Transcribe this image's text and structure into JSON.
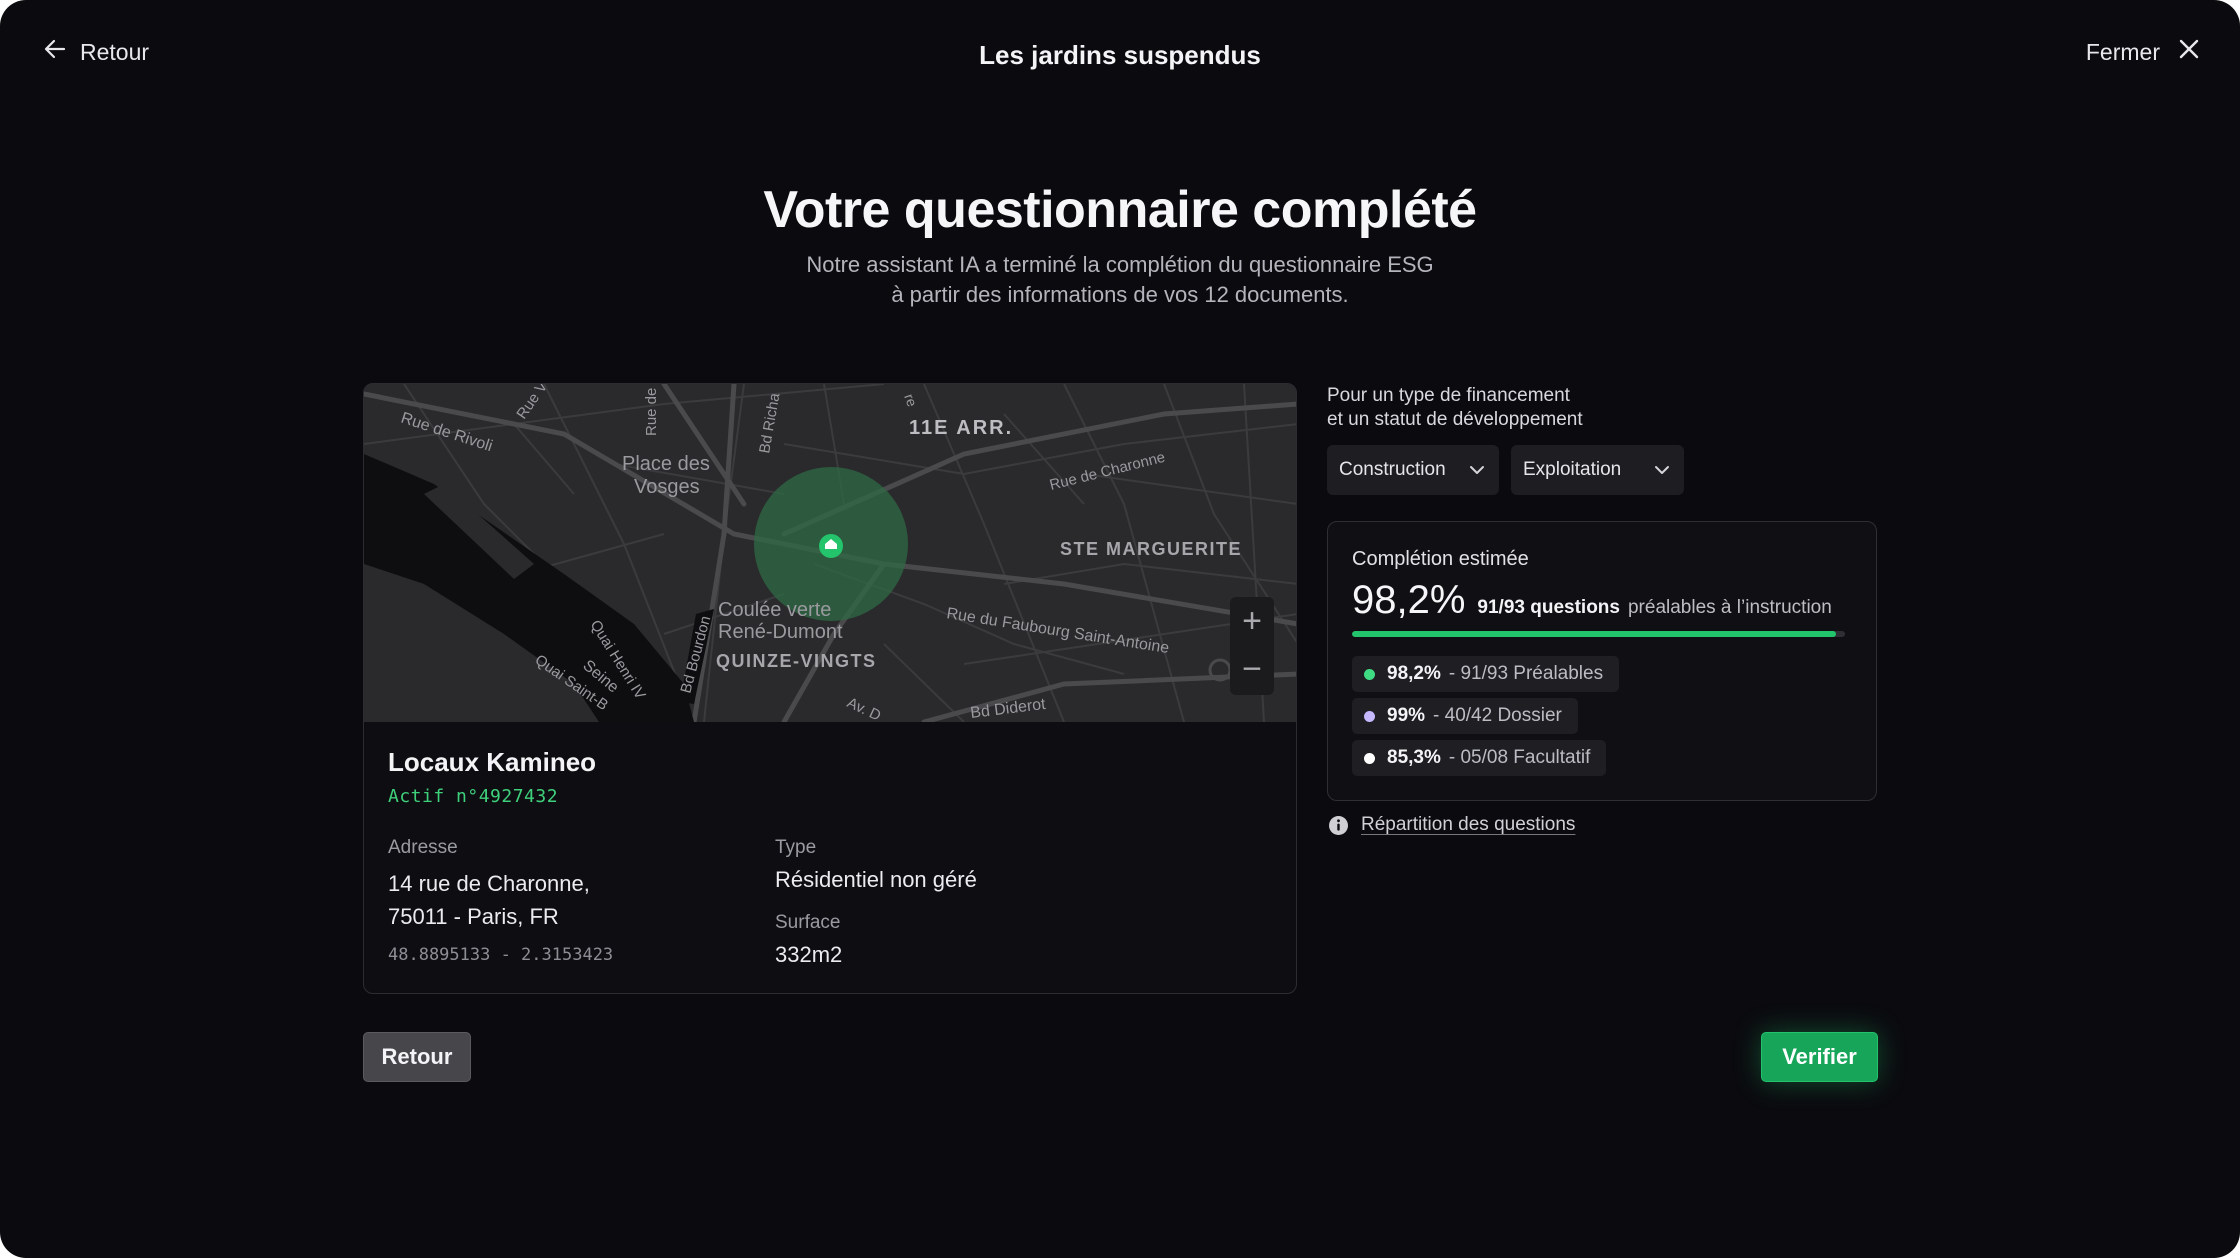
{
  "header": {
    "back_label": "Retour",
    "title": "Les jardins suspendus",
    "close_label": "Fermer"
  },
  "hero": {
    "title": "Votre questionnaire complété",
    "subtitle_line1": "Notre assistant IA a terminé la complétion du questionnaire ESG",
    "subtitle_line2": "à partir des informations de vos 12 documents."
  },
  "map": {
    "labels": {
      "rue_rivoli": "Rue de Rivoli",
      "rue_v": "Rue V",
      "rue_de": "Rue de",
      "bd_richa": "Bd Richa",
      "re": "re",
      "arr": "11E ARR.",
      "place_vosges_1": "Place des",
      "place_vosges_2": "Vosges",
      "rue_charonne": "Rue de Charonne",
      "ste_marguerite": "STE MARGUERITE",
      "coulee_1": "Coulée verte",
      "coulee_2": "René-Dumont",
      "quinze_vingts": "QUINZE-VINGTS",
      "faubourg": "Rue du Faubourg Saint-Antoine",
      "bd_diderot": "Bd Diderot",
      "av_d": "Av. D",
      "bd_bourdon": "Bd Bourdon",
      "quai_henri": "Quai Henri IV",
      "seine": "Seine",
      "quai_saint": "Quai Saint-B"
    },
    "zoom_in": "+",
    "zoom_out": "−"
  },
  "asset": {
    "name": "Locaux Kamineo",
    "id": "Actif n°4927432",
    "address_label": "Adresse",
    "address_line1": "14 rue de Charonne,",
    "address_line2": "75011 - Paris, FR",
    "coordinates": "48.8895133 - 2.3153423",
    "type_label": "Type",
    "type_value": "Résidentiel non géré",
    "surface_label": "Surface",
    "surface_value": "332m2"
  },
  "financing": {
    "label_line1": "Pour un type de financement",
    "label_line2": "et un statut de développement",
    "type_selected": "Construction",
    "status_selected": "Exploitation"
  },
  "completion": {
    "label": "Complétion estimée",
    "percent": "98,2%",
    "progress": 0.982,
    "questions": "91/93 questions",
    "suffix": "préalables à l’instruction",
    "stats": [
      {
        "percent": "98,2%",
        "detail": "- 91/93 Préalables",
        "color": "#3fdc83"
      },
      {
        "percent": "99%",
        "detail": "- 40/42 Dossier",
        "color": "#c6b8ff"
      },
      {
        "percent": "85,3%",
        "detail": "- 05/08 Facultatif",
        "color": "#ffffff"
      }
    ],
    "info_link": "Répartition des questions"
  },
  "actions": {
    "back_label": "Retour",
    "verify_label": "Verifier"
  },
  "colors": {
    "accent": "#22c46c",
    "background": "#0b0b0f"
  }
}
